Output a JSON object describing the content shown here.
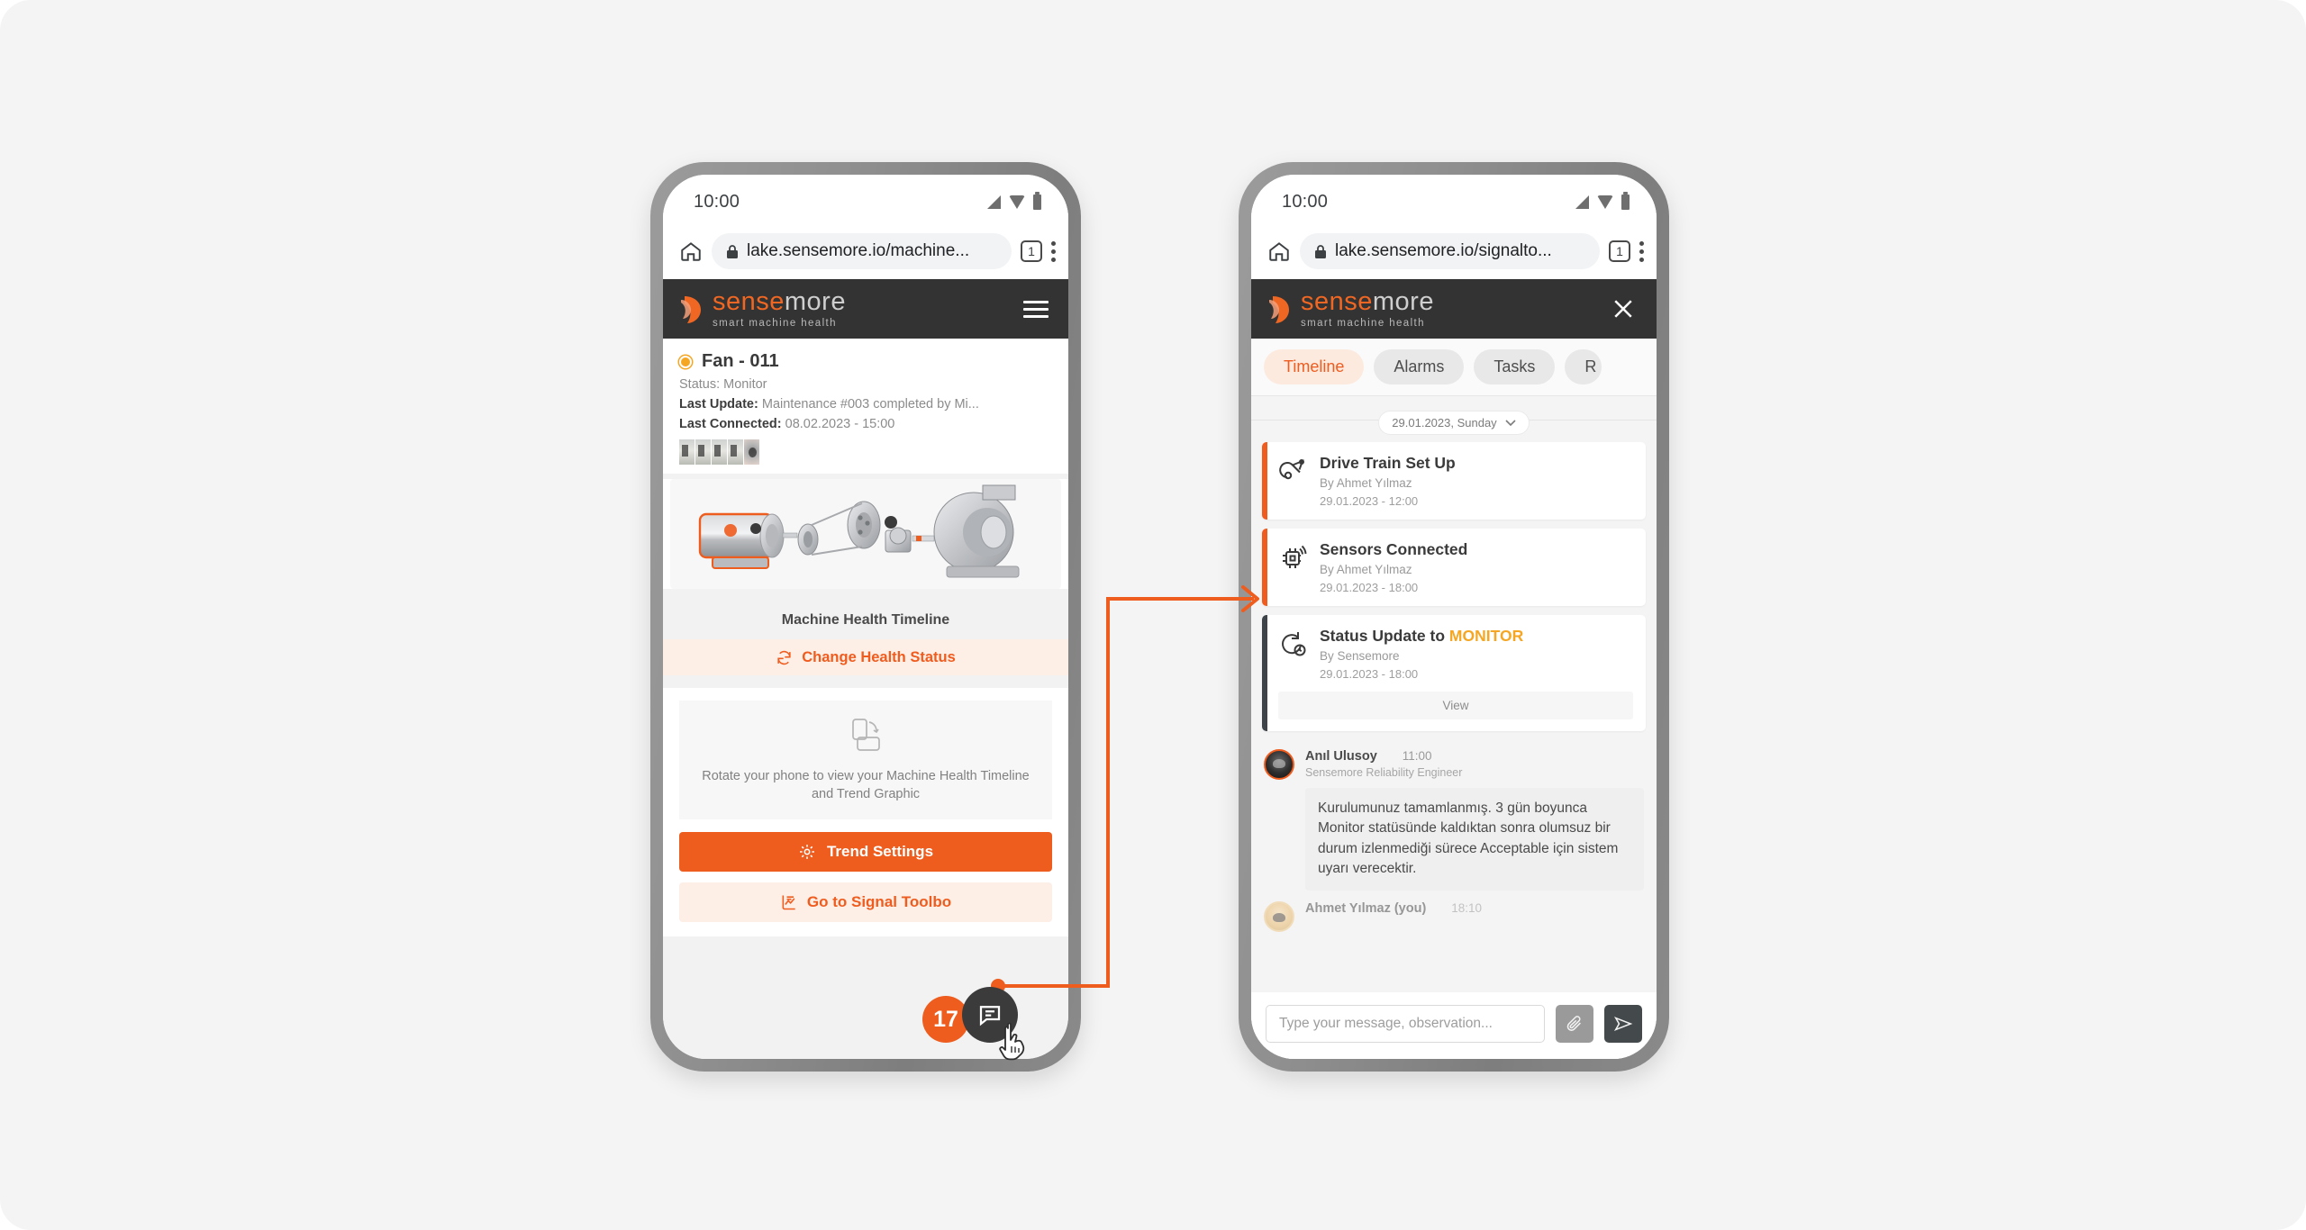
{
  "accent_color": "#ee5c1e",
  "accent_soft": "#fdeee6",
  "dark_header": "#333333",
  "monitor_color": "#f5a623",
  "page_bg": "#f4f4f4",
  "left_phone": {
    "status": {
      "time": "10:00",
      "signal_icon": "signal-icon",
      "wifi_icon": "wifi-icon",
      "battery_icon": "battery-icon"
    },
    "browser": {
      "home_icon": "home-icon",
      "lock_icon": "lock-icon",
      "url": "lake.sensemore.io/machine...",
      "tab_count": "1",
      "menu_icon": "kebab-menu-icon"
    },
    "app_header": {
      "brand": "sense",
      "brand2": "more",
      "tagline": "smart machine health",
      "menu_icon": "hamburger-icon"
    },
    "machine": {
      "name": "Fan - 011",
      "status_line": "Status: Monitor",
      "last_update_label": "Last Update:",
      "last_update_value": "Maintenance #003 completed by Mi...",
      "last_connected_label": "Last Connected:",
      "last_connected_value": "08.02.2023 - 15:00"
    },
    "timeline_label": "Machine Health Timeline",
    "change_status_button": "Change Health Status",
    "rotate_hint": "Rotate your phone to view your Machine Health Timeline and Trend Graphic",
    "trend_settings_button": "Trend Settings",
    "signal_toolbox_button": "Go to Signal Toolbo",
    "fab": {
      "badge_count": "17",
      "icon": "chat-bubble-icon"
    }
  },
  "right_phone": {
    "status": {
      "time": "10:00"
    },
    "browser": {
      "url": "lake.sensemore.io/signalto...",
      "tab_count": "1"
    },
    "app_header": {
      "brand": "sense",
      "brand2": "more",
      "tagline": "smart machine health",
      "close_icon": "close-icon"
    },
    "tabs": [
      {
        "label": "Timeline",
        "active": true
      },
      {
        "label": "Alarms",
        "active": false
      },
      {
        "label": "Tasks",
        "active": false
      },
      {
        "label": "R",
        "active": false
      }
    ],
    "date_chip": "29.01.2023, Sunday",
    "timeline_events": [
      {
        "title": "Drive Train Set Up",
        "by": "By Ahmet Yılmaz",
        "date": "29.01.2023 - 12:00",
        "icon": "drive-train-icon",
        "accent": "orange"
      },
      {
        "title": "Sensors Connected",
        "by": "By Ahmet Yılmaz",
        "date": "29.01.2023 - 18:00",
        "icon": "sensor-chip-icon",
        "accent": "orange"
      },
      {
        "title_prefix": "Status Update to ",
        "title_highlight": "MONITOR",
        "by": "By Sensemore",
        "date": "29.01.2023 - 18:00",
        "icon": "status-update-icon",
        "accent": "dark",
        "action": "View"
      }
    ],
    "messages": [
      {
        "name": "Anıl Ulusoy",
        "time": "11:00",
        "role": "Sensemore Reliability Engineer",
        "text": "Kurulumunuz tamamlanmış. 3 gün boyunca Monitor statüsünde kaldıktan sonra olumsuz bir durum izlenmediği sürece Acceptable için sistem uyarı verecektir."
      },
      {
        "name": "Ahmet Yılmaz (you)",
        "time": "18:10",
        "role": "",
        "text": ""
      }
    ],
    "composer": {
      "placeholder": "Type your message, observation...",
      "value": "",
      "attach_icon": "paperclip-icon",
      "send_icon": "send-icon"
    }
  }
}
